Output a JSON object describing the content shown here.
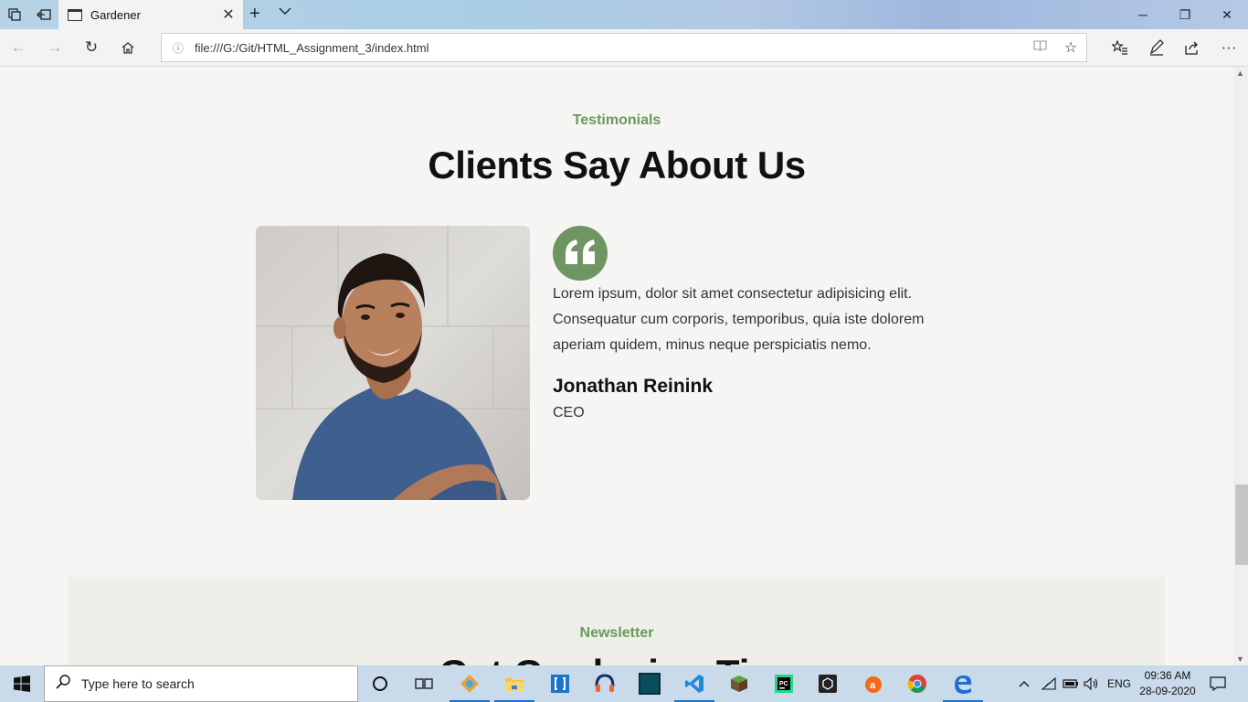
{
  "browser": {
    "tab_title": "Gardener",
    "url": "file:///G:/Git/HTML_Assignment_3/index.html"
  },
  "testimonials": {
    "eyebrow": "Testimonials",
    "title": "Clients Say About Us",
    "quote": "Lorem ipsum, dolor sit amet consectetur adipisicing elit. Consequatur cum corporis, temporibus, quia iste dolorem aperiam quidem, minus neque perspiciatis nemo.",
    "name": "Jonathan Reinink",
    "role": "CEO"
  },
  "newsletter": {
    "eyebrow": "Newsletter",
    "title": "Get Gardening Tips"
  },
  "taskbar": {
    "search_placeholder": "Type here to search",
    "language": "ENG",
    "time": "09:36 AM",
    "date": "28-09-2020"
  },
  "colors": {
    "accent_green": "#6a9a5a",
    "page_bg": "#f6f5f3"
  }
}
